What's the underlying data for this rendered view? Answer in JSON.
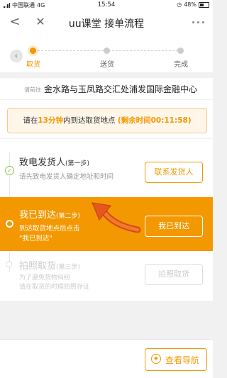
{
  "status_bar": {
    "carrier": "中国联通",
    "network": "4G",
    "time": "15:54",
    "battery": "48%"
  },
  "nav": {
    "title": "uu课堂 接单流程"
  },
  "stepper": {
    "steps": [
      "取货",
      "送货",
      "完成"
    ],
    "active_index": 0
  },
  "address": {
    "prefix": "请前往",
    "text": "金水路与玉凤路交汇处浦发国际金融中心"
  },
  "timer": {
    "pre": "请在",
    "minutes": "13分钟",
    "mid": "内到达取货地点",
    "remaining": "(剩余时间00:11:58)"
  },
  "steps": [
    {
      "title": "致电发货人",
      "tag": "(第一步)",
      "desc": "请先致电发货人确定地址和时间",
      "button": "联系发货人"
    },
    {
      "title": "我已到达",
      "tag": "(第二步)",
      "desc_line1": "到达取货地点后点击",
      "desc_line2": "\"我已到达\"",
      "button": "我已到达"
    },
    {
      "title": "拍照取货",
      "tag": "(第三步)",
      "desc_line1": "为了避免货物纠纷",
      "desc_line2": "请在取货的时候拍照存证",
      "button": "拍照取货"
    }
  ],
  "bottom": {
    "nav_button": "查看导航"
  },
  "colors": {
    "accent": "#f39800",
    "success": "#8bc34a"
  },
  "icons": [
    "back-icon",
    "close-icon",
    "more-icon",
    "check-icon",
    "compass-icon"
  ]
}
